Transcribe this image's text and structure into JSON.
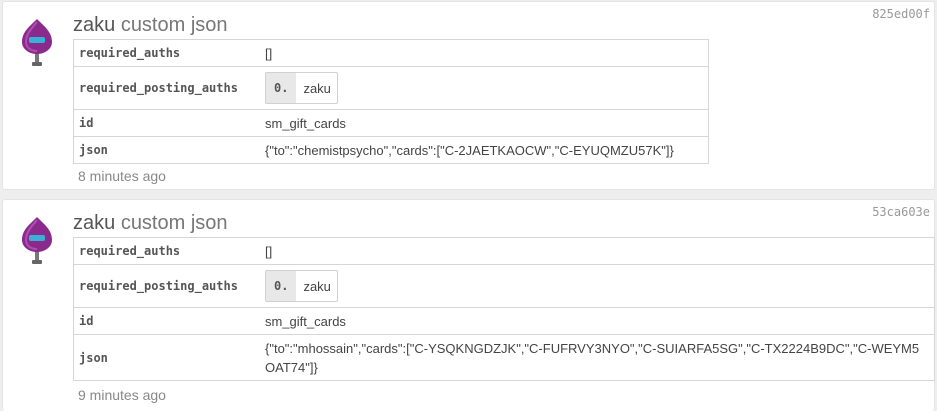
{
  "operations": [
    {
      "user": "zaku",
      "type": "custom json",
      "txid": "825ed00f",
      "fields": {
        "required_auths_label": "required_auths",
        "required_auths_value": "[]",
        "required_posting_auths_label": "required_posting_auths",
        "posting_index": "0.",
        "posting_value": "zaku",
        "id_label": "id",
        "id_value": "sm_gift_cards",
        "json_label": "json",
        "json_value": "{\"to\":\"chemistpsycho\",\"cards\":[\"C-2JAETKAOCW\",\"C-EYUQMZU57K\"]}"
      },
      "time": "8 minutes ago"
    },
    {
      "user": "zaku",
      "type": "custom json",
      "txid": "53ca603e",
      "fields": {
        "required_auths_label": "required_auths",
        "required_auths_value": "[]",
        "required_posting_auths_label": "required_posting_auths",
        "posting_index": "0.",
        "posting_value": "zaku",
        "id_label": "id",
        "id_value": "sm_gift_cards",
        "json_label": "json",
        "json_value": "{\"to\":\"mhossain\",\"cards\":[\"C-YSQKNGDZJK\",\"C-FUFRVY3NYO\",\"C-SUIARFA5SG\",\"C-TX2224B9DC\",\"C-WEYM5OAT74\"]}"
      },
      "time": "9 minutes ago"
    }
  ],
  "icons": {
    "avatar": "purple-robot-avatar-icon"
  }
}
